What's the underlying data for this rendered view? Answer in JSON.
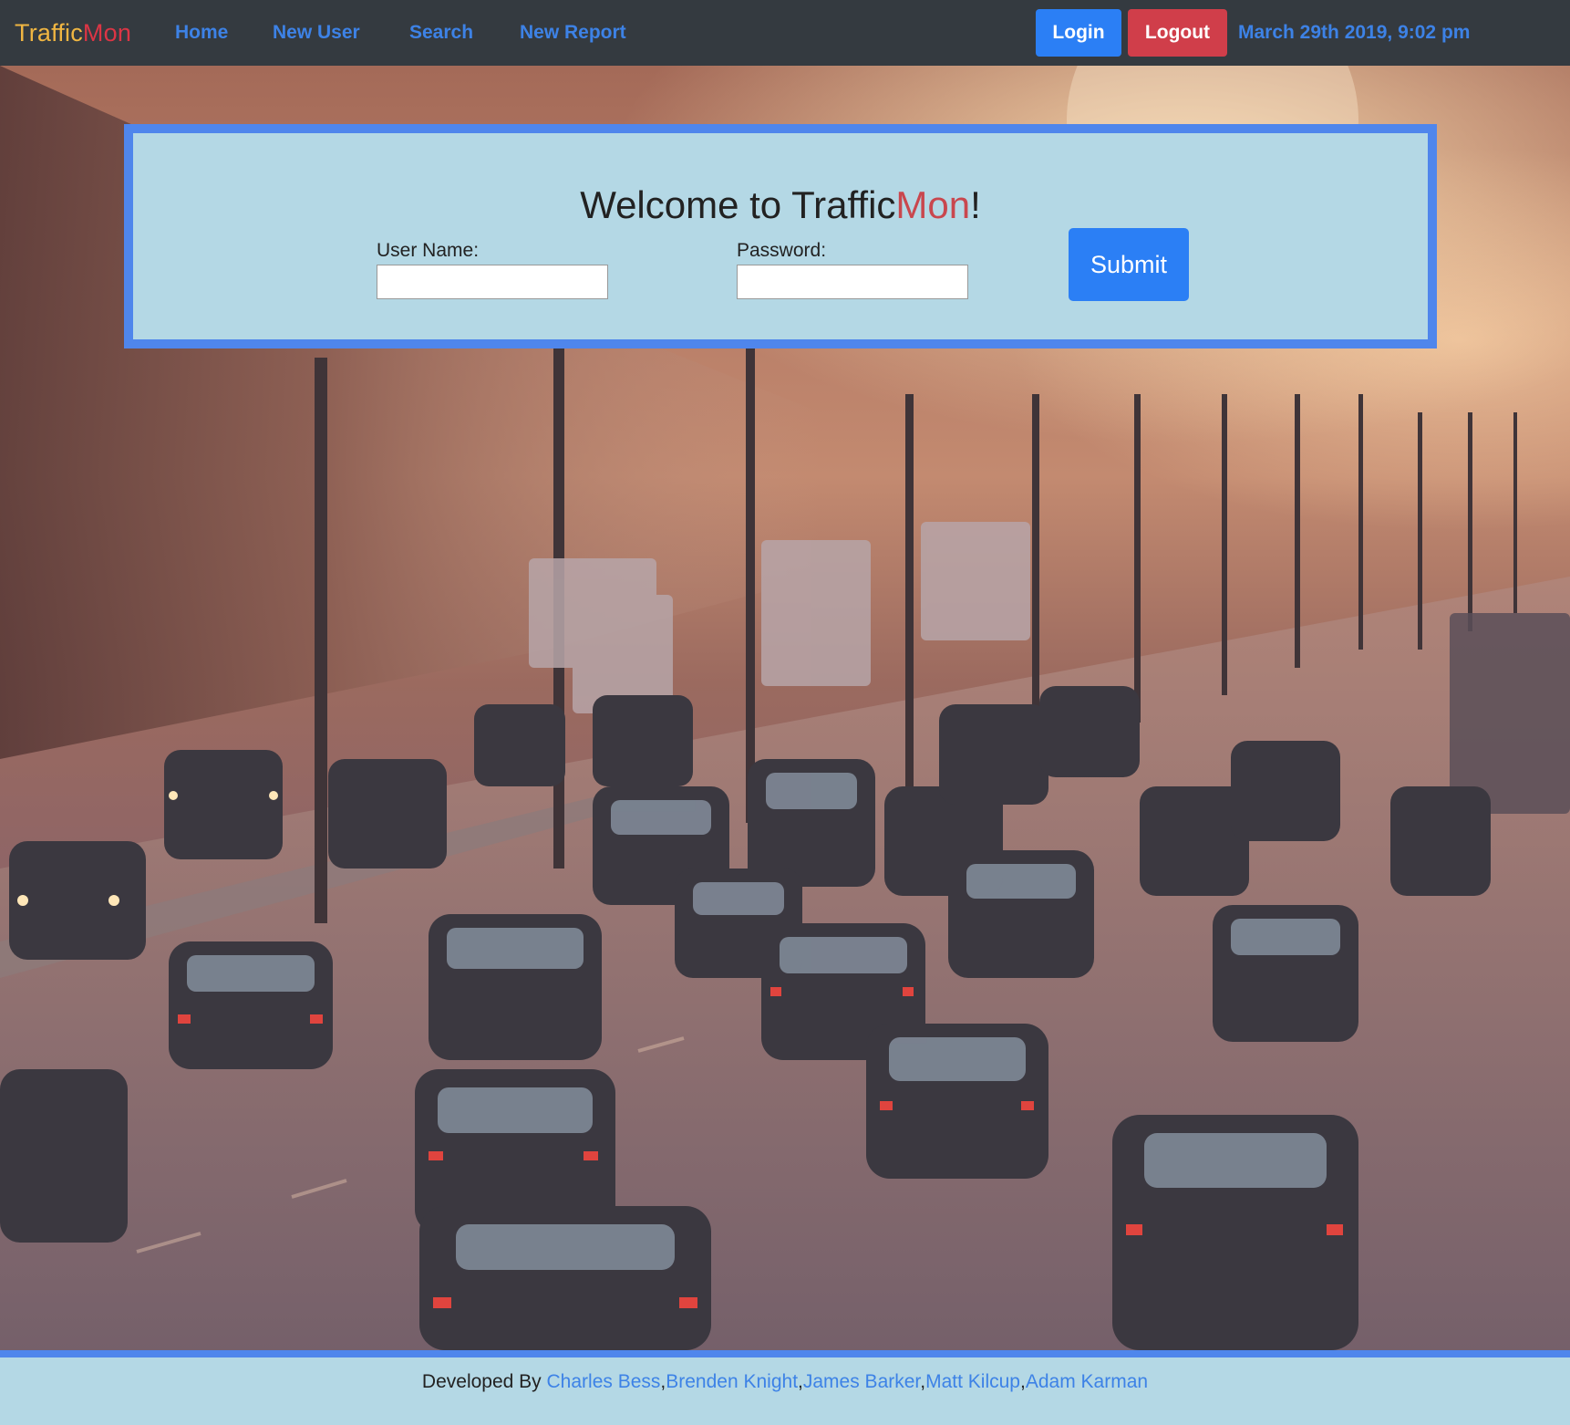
{
  "navbar": {
    "brand": {
      "part1": "Traffic",
      "part2": "Mon"
    },
    "links": [
      "Home",
      "New User",
      "Search",
      "New Report"
    ],
    "login_label": "Login",
    "logout_label": "Logout",
    "datetime": "March 29th 2019, 9:02 pm"
  },
  "colors": {
    "navbar_bg": "#343a40",
    "brand_yellow": "#f0b642",
    "brand_red": "#dc3545",
    "link_blue": "#3d82e6",
    "primary_button": "#2b7ff5",
    "danger_button": "#d03e4a",
    "panel_bg": "#b4d8e5",
    "panel_border": "#4f86ec"
  },
  "hero_image": {
    "icon": "highway-traffic-photo"
  },
  "login_panel": {
    "title_prefix": "Welcome to Traffic",
    "title_accent": "Mon",
    "title_suffix": "!",
    "username_label": "User Name:",
    "username_value": "",
    "password_label": "Password:",
    "password_value": "",
    "submit_label": "Submit"
  },
  "footer": {
    "prefix": "Developed By ",
    "developers": [
      "Charles Bess",
      "Brenden Knight",
      "James Barker",
      "Matt Kilcup",
      "Adam Karman"
    ],
    "separator": ","
  }
}
